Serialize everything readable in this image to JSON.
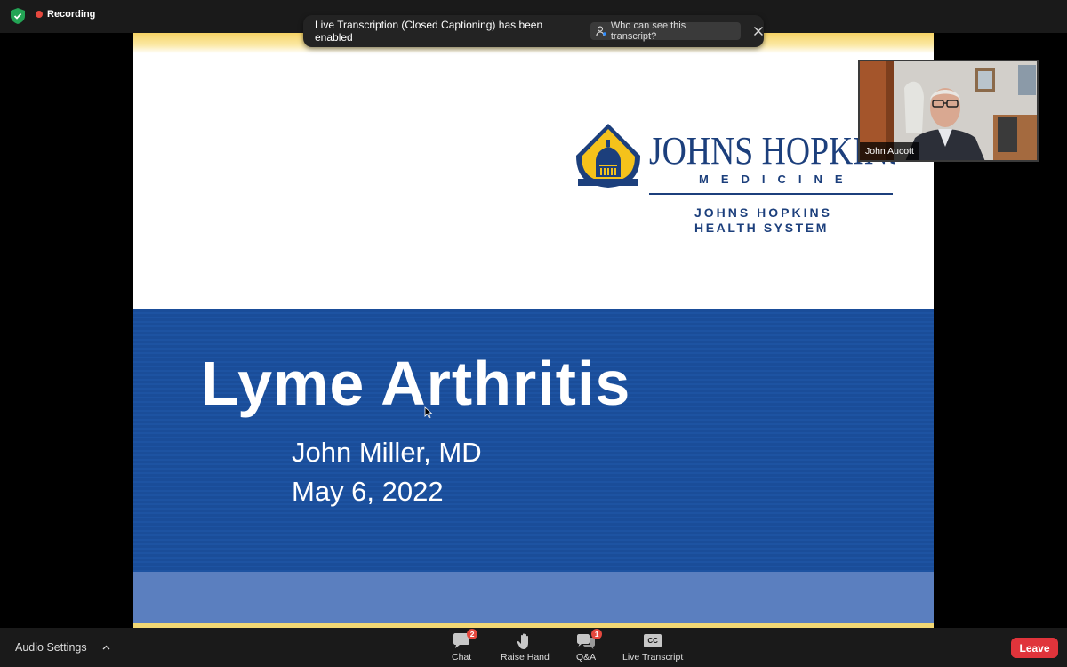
{
  "topbar": {
    "recording_label": "Recording"
  },
  "toast": {
    "message": "Live Transcription (Closed Captioning) has been enabled",
    "link_label": "Who can see this transcript?"
  },
  "slide": {
    "logo": {
      "line1": "JOHNS HOPKINS",
      "line2": "MEDICINE",
      "line3": "JOHNS HOPKINS",
      "line4": "HEALTH SYSTEM"
    },
    "title": "Lyme Arthritis",
    "author": "John Miller, MD",
    "date": "May 6, 2022"
  },
  "video": {
    "participant_name": "John Aucott"
  },
  "toolbar": {
    "audio_settings_label": "Audio Settings",
    "chat": {
      "label": "Chat",
      "badge": "2"
    },
    "raise_hand": {
      "label": "Raise Hand"
    },
    "qa": {
      "label": "Q&A",
      "badge": "1"
    },
    "live_transcript": {
      "label": "Live Transcript",
      "icon_text": "CC"
    },
    "leave_label": "Leave"
  },
  "colors": {
    "slide_blue": "#1a4d99",
    "slide_light_blue": "#5b7fbf",
    "leave_red": "#e0343b",
    "badge_red": "#e5483e",
    "jh_navy": "#1c3f7c",
    "jh_gold": "#f5c21b"
  }
}
